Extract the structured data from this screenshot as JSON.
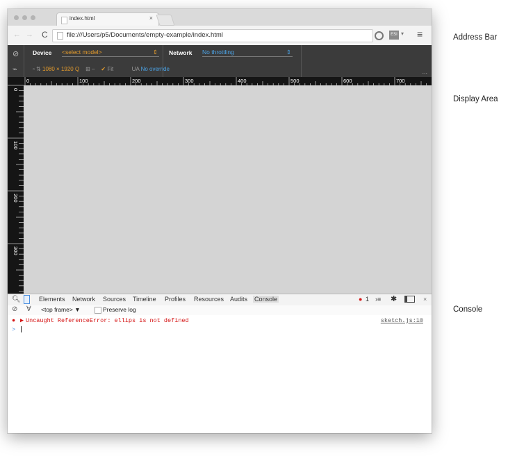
{
  "browser": {
    "tab": {
      "title": "index.html",
      "close": "×"
    },
    "toolbar": {
      "back": "←",
      "forward": "→",
      "reload": "C",
      "url": "file:///Users/p5/Documents/empty-example/index.html",
      "extension_label": "ESI",
      "extension_caret": "▾",
      "menu": "≡"
    }
  },
  "emulation": {
    "device_label": "Device",
    "device_value": "<select model>",
    "network_label": "Network",
    "network_value": "No throttling",
    "resolution_width": "1080",
    "times": "×",
    "resolution_height": "1920",
    "fit_label": "Fit",
    "ua_label": "UA",
    "ua_value": "No override",
    "more": "..."
  },
  "rulers": {
    "horizontal": [
      "0",
      "100",
      "200",
      "300",
      "400",
      "500",
      "600",
      "700"
    ],
    "vertical": [
      "0",
      "100",
      "200",
      "300"
    ]
  },
  "devtools": {
    "tabs": [
      "Elements",
      "Network",
      "Sources",
      "Timeline",
      "Profiles",
      "Resources",
      "Audits",
      "Console"
    ],
    "active_tab": "Console",
    "error_count": "1",
    "close": "×"
  },
  "console": {
    "frame_selector": "<top frame>",
    "frame_caret": "▼",
    "preserve_log": "Preserve log",
    "error_message": "Uncaught ReferenceError: ellips is not defined",
    "error_source": "sketch.js:10",
    "prompt": ">"
  },
  "annotations": {
    "address_bar": "Address Bar",
    "display_area": "Display Area",
    "console": "Console"
  },
  "colors": {
    "emulation_bg": "#3b3b3b",
    "device_select": "#e59c2c",
    "network_select": "#4ba3e6",
    "ruler_bg": "#151515",
    "display_bg": "#d4d4d4",
    "error_text": "#d51515"
  }
}
